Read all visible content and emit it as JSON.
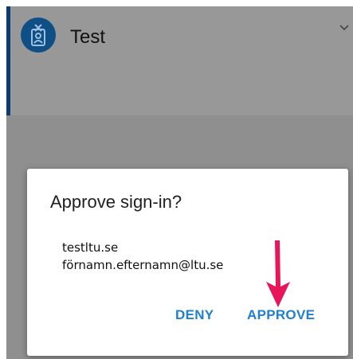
{
  "account": {
    "name": "Test",
    "icon": "badge-icon"
  },
  "dialog": {
    "title": "Approve sign-in?",
    "line1": "testltu.se",
    "line2": "förnamn.efternamn@ltu.se",
    "deny_label": "DENY",
    "approve_label": "APPROVE"
  },
  "colors": {
    "accent": "#0b3d73",
    "button": "#1f7fd1",
    "arrow": "#e8155a"
  }
}
